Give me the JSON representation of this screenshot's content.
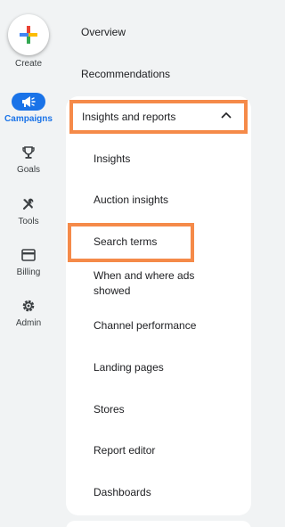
{
  "rail": {
    "create_label": "Create",
    "items": [
      {
        "label": "Campaigns",
        "icon": "megaphone-icon",
        "active": true
      },
      {
        "label": "Goals",
        "icon": "trophy-icon"
      },
      {
        "label": "Tools",
        "icon": "tools-icon"
      },
      {
        "label": "Billing",
        "icon": "credit-card-icon"
      },
      {
        "label": "Admin",
        "icon": "gear-icon"
      }
    ]
  },
  "nav": {
    "top_items": [
      "Overview",
      "Recommendations"
    ],
    "section": {
      "label": "Insights and reports",
      "expanded": true,
      "items": [
        "Insights",
        "Auction insights",
        "Search terms",
        "When and where ads showed",
        "Channel performance",
        "Landing pages",
        "Stores",
        "Report editor",
        "Dashboards"
      ]
    }
  },
  "colors": {
    "accent": "#1a73e8",
    "highlight": "#f58a49",
    "google_blue": "#4285f4",
    "google_red": "#ea4335",
    "google_yellow": "#fbbc04",
    "google_green": "#34a853"
  }
}
